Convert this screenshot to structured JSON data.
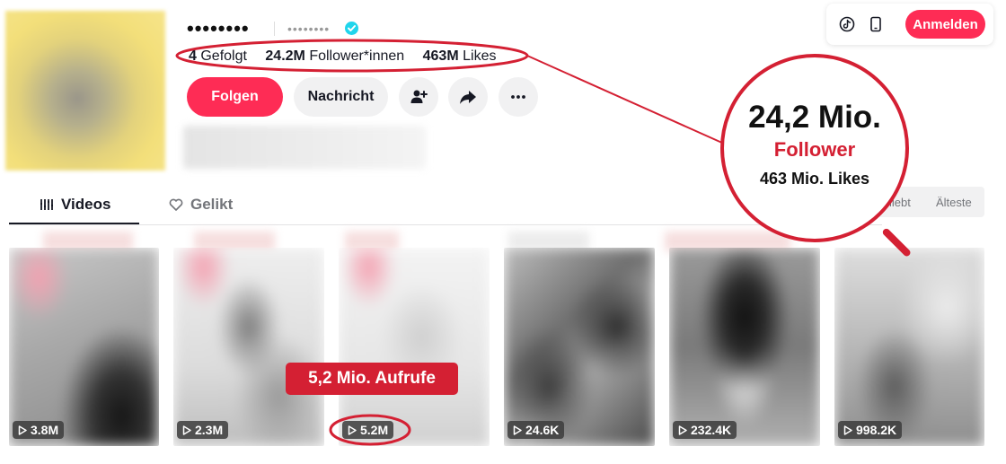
{
  "profile": {
    "username_masked": "••••••••",
    "nickname_masked": "••••••••",
    "verified": true,
    "stats": {
      "following_value": "4",
      "following_label": "Gefolgt",
      "followers_value": "24.2M",
      "followers_label": "Follower*innen",
      "likes_value": "463M",
      "likes_label": "Likes"
    },
    "actions": {
      "follow_label": "Folgen",
      "message_label": "Nachricht",
      "add_friend_icon": "add-user-icon",
      "share_icon": "share-icon",
      "more_icon": "more-icon"
    }
  },
  "topbar": {
    "tiktok_icon": "tiktok-icon",
    "mobile_icon": "phone-icon",
    "login_label": "Anmelden"
  },
  "tabs": {
    "videos_label": "Videos",
    "liked_label": "Gelikt",
    "sort_popular_partial": "liebt",
    "sort_oldest": "Älteste"
  },
  "videos": [
    {
      "views": "3.8M"
    },
    {
      "views": "2.3M"
    },
    {
      "views": "5.2M"
    },
    {
      "views": "24.6K"
    },
    {
      "views": "232.4K"
    },
    {
      "views": "998.2K"
    }
  ],
  "annotations": {
    "magnifier_line1": "24,2 Mio.",
    "magnifier_line2": "Follower",
    "magnifier_line3": "463 Mio. Likes",
    "callout": "5,2 Mio. Aufrufe"
  },
  "colors": {
    "brand": "#fe2c55",
    "annotation_red": "#d42033",
    "verified": "#20d5ec"
  }
}
